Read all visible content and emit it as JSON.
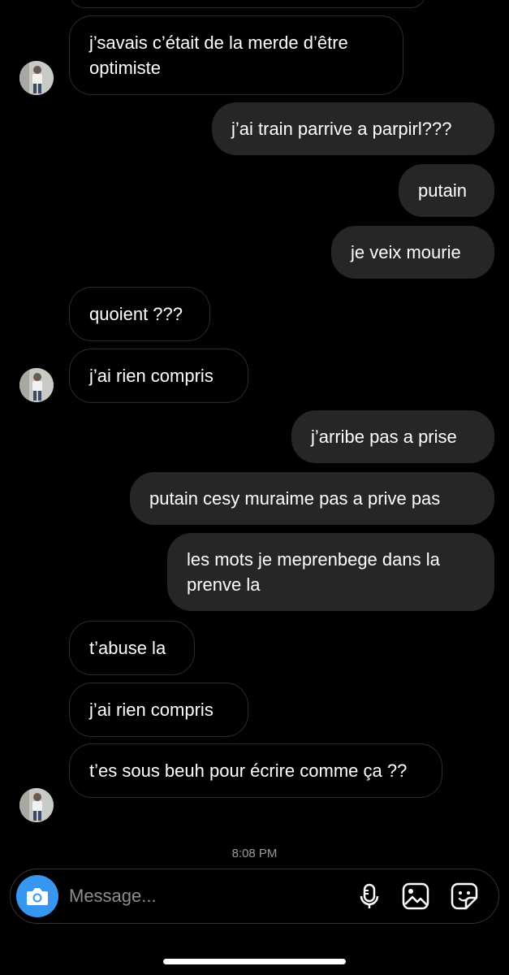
{
  "messages": [
    {
      "side": "in",
      "text": "j’savais c’était de la merde d’être optimiste"
    },
    {
      "side": "out",
      "text": "j’ai train parrive a parpirl???"
    },
    {
      "side": "out",
      "text": "putain"
    },
    {
      "side": "out",
      "text": "je veix mourie"
    },
    {
      "side": "in",
      "text": "quoient ???"
    },
    {
      "side": "in",
      "text": "j’ai rien compris"
    },
    {
      "side": "out",
      "text": "j’arribe pas a prise"
    },
    {
      "side": "out",
      "text": "putain cesy muraime pas a prive pas"
    },
    {
      "side": "out",
      "text": "les mots je meprenbege dans la prenve la"
    },
    {
      "side": "in",
      "text": "t’abuse la"
    },
    {
      "side": "in",
      "text": "j’ai rien compris"
    },
    {
      "side": "in",
      "text": "t’es sous beuh pour écrire comme ça ??"
    }
  ],
  "timestamp": "8:08 PM",
  "composer": {
    "placeholder": "Message...",
    "camera_icon": "camera-icon",
    "mic_icon": "microphone-icon",
    "gallery_icon": "image-icon",
    "sticker_icon": "sticker-icon"
  },
  "colors": {
    "background": "#000000",
    "outgoing_bubble": "#262626",
    "incoming_border": "#2c2c2e",
    "accent": "#3797f0",
    "timestamp": "#9a9a9a"
  }
}
